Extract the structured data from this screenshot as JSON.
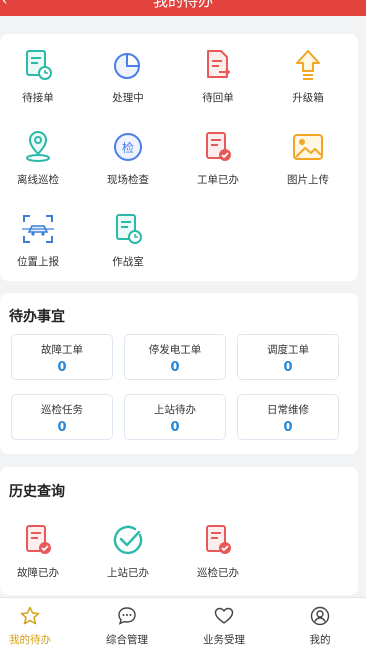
{
  "header": {
    "title": "我的待办",
    "back_icon": "back-icon"
  },
  "quick_actions": [
    {
      "label": "待接单",
      "icon": "pending-order-icon"
    },
    {
      "label": "处理中",
      "icon": "pie-chart-icon"
    },
    {
      "label": "待回单",
      "icon": "return-order-icon"
    },
    {
      "label": "升级箱",
      "icon": "upgrade-arrow-icon"
    },
    {
      "label": "离线巡检",
      "icon": "location-pin-icon"
    },
    {
      "label": "现场检查",
      "icon": "inspection-badge-icon"
    },
    {
      "label": "工单已办",
      "icon": "order-done-icon"
    },
    {
      "label": "图片上传",
      "icon": "image-upload-icon"
    },
    {
      "label": "位置上报",
      "icon": "scan-car-icon"
    },
    {
      "label": "作战室",
      "icon": "war-room-icon"
    }
  ],
  "todo": {
    "title": "待办事宜",
    "items": [
      {
        "label": "故障工单",
        "value": "0"
      },
      {
        "label": "停发电工单",
        "value": "0"
      },
      {
        "label": "调度工单",
        "value": "0"
      },
      {
        "label": "巡检任务",
        "value": "0"
      },
      {
        "label": "上站待办",
        "value": "0"
      },
      {
        "label": "日常维修",
        "value": "0"
      }
    ]
  },
  "history": {
    "title": "历史查询",
    "items": [
      {
        "label": "故障已办",
        "icon": "fault-done-icon"
      },
      {
        "label": "上站已办",
        "icon": "check-circle-icon"
      },
      {
        "label": "巡检已办",
        "icon": "inspection-done-icon"
      }
    ]
  },
  "tabs": [
    {
      "label": "我的待办",
      "icon": "star-icon"
    },
    {
      "label": "综合管理",
      "icon": "chat-bubble-icon"
    },
    {
      "label": "业务受理",
      "icon": "heart-icon"
    },
    {
      "label": "我的",
      "icon": "user-icon"
    }
  ],
  "colors": {
    "brand": "#e2433c",
    "active_tab": "#d4a017",
    "value_blue": "#2a86d6"
  }
}
